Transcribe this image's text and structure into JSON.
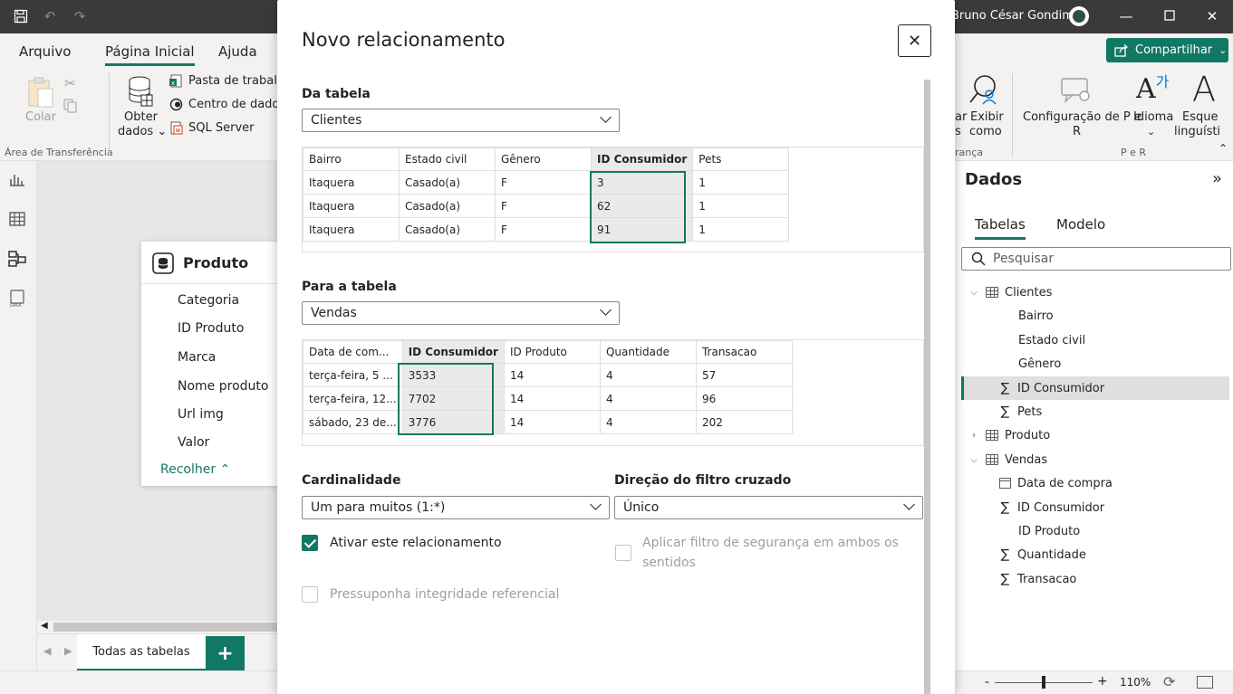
{
  "window": {
    "user_name": "Bruno César Gondim"
  },
  "ribbon": {
    "tabs": [
      "Arquivo",
      "Página Inicial",
      "Ajuda"
    ],
    "colar": "Colar",
    "area_transferencia": "Área de Transferência",
    "obter_dados_1": "Obter",
    "obter_dados_2": "dados",
    "pasta_trabalho": "Pasta de trabalho",
    "centro_dados": "Centro de dados",
    "sql_server": "SQL Server",
    "exibir_como_1": "Exibir",
    "exibir_como_2": "como",
    "partial_1": "ar",
    "partial_2": "s",
    "partial_3": "rança",
    "config_1": "Configuração de P e",
    "config_2": "R",
    "idioma": "Idioma",
    "esquema_1": "Esque",
    "esquema_2": "linguísti",
    "per_group": "P e R",
    "share": "Compartilhar"
  },
  "canvas": {
    "card_title": "Produto",
    "fields": [
      "Categoria",
      "ID Produto",
      "Marca",
      "Nome produto",
      "Url img",
      "Valor"
    ],
    "collapse": "Recolher",
    "page_tab": "Todas as tabelas",
    "add_page": "+"
  },
  "status": {
    "zoom": "110%"
  },
  "data_panel": {
    "title": "Dados",
    "tabs": [
      "Tabelas",
      "Modelo"
    ],
    "search_placeholder": "Pesquisar",
    "tree": [
      {
        "kind": "table",
        "label": "Clientes",
        "expanded": true
      },
      {
        "kind": "field",
        "label": "Bairro"
      },
      {
        "kind": "field",
        "label": "Estado civil"
      },
      {
        "kind": "field",
        "label": "Gênero"
      },
      {
        "kind": "measure",
        "label": "ID Consumidor",
        "selected": true
      },
      {
        "kind": "measure",
        "label": "Pets"
      },
      {
        "kind": "table",
        "label": "Produto",
        "expanded": false
      },
      {
        "kind": "table",
        "label": "Vendas",
        "expanded": true
      },
      {
        "kind": "date",
        "label": "Data de compra"
      },
      {
        "kind": "measure",
        "label": "ID Consumidor"
      },
      {
        "kind": "field",
        "label": "ID Produto"
      },
      {
        "kind": "measure",
        "label": "Quantidade"
      },
      {
        "kind": "measure",
        "label": "Transacao"
      }
    ]
  },
  "dialog": {
    "title": "Novo relacionamento",
    "from_label": "Da tabela",
    "from_table": "Clientes",
    "from_columns": [
      "Bairro",
      "Estado civil",
      "Gênero",
      "ID Consumidor",
      "Pets"
    ],
    "from_rows": [
      [
        "Itaquera",
        "Casado(a)",
        "F",
        "3",
        "1"
      ],
      [
        "Itaquera",
        "Casado(a)",
        "F",
        "62",
        "1"
      ],
      [
        "Itaquera",
        "Casado(a)",
        "F",
        "91",
        "1"
      ]
    ],
    "to_label": "Para a tabela",
    "to_table": "Vendas",
    "to_columns": [
      "Data de com...",
      "ID Consumidor",
      "ID Produto",
      "Quantidade",
      "Transacao"
    ],
    "to_rows": [
      [
        "terça-feira, 5 ...",
        "3533",
        "14",
        "4",
        "57"
      ],
      [
        "terça-feira, 12...",
        "7702",
        "14",
        "4",
        "96"
      ],
      [
        "sábado, 23 de...",
        "3776",
        "14",
        "4",
        "202"
      ]
    ],
    "cardinality_label": "Cardinalidade",
    "cardinality_value": "Um para muitos (1:*)",
    "filter_label": "Direção do filtro cruzado",
    "filter_value": "Único",
    "activate_label": "Ativar este relacionamento",
    "security_label_1": "Aplicar filtro de segurança em ambos os",
    "security_label_2": "sentidos",
    "integrity_label": "Pressuponha integridade referencial",
    "accent_color": "#117865"
  }
}
